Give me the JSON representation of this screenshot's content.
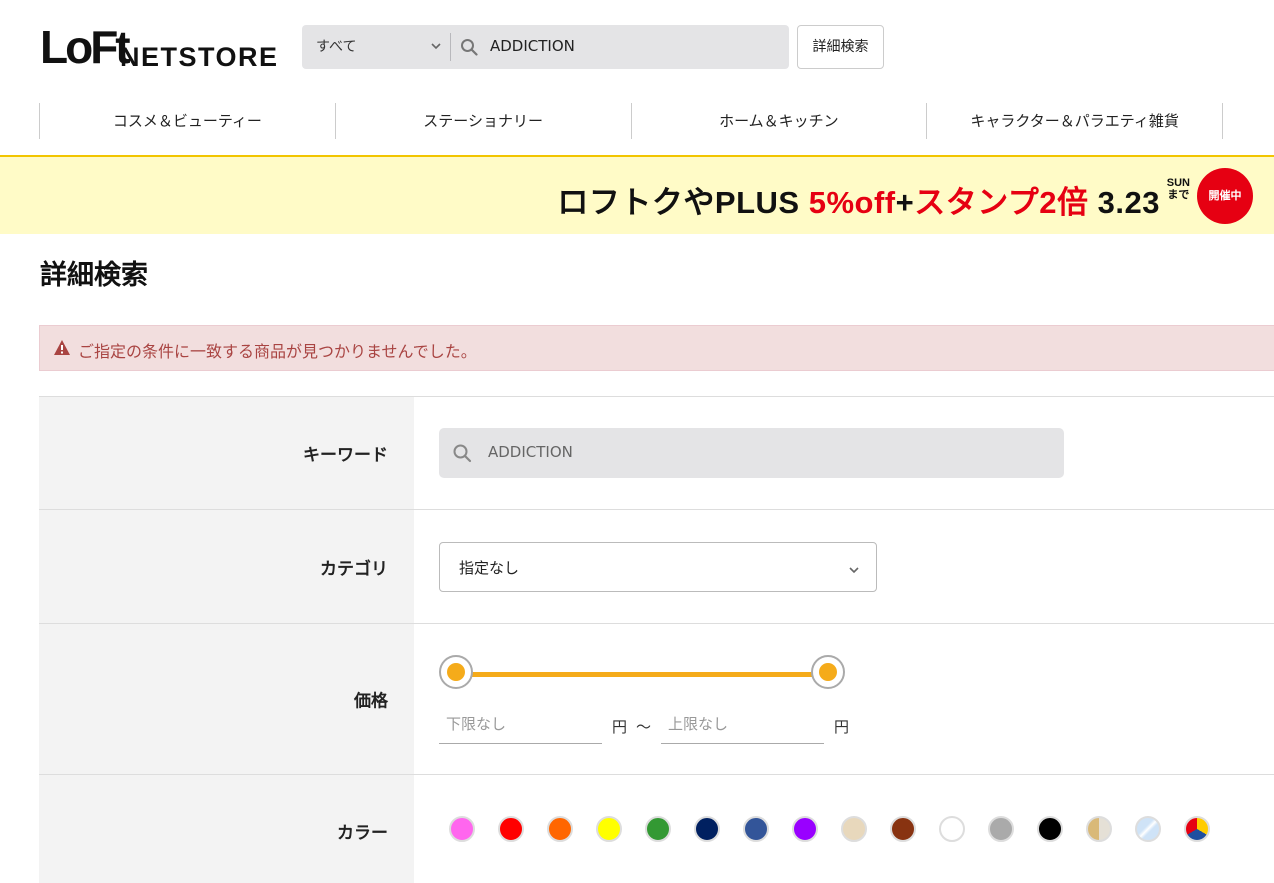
{
  "header": {
    "logo_mark": "LoFt",
    "logo_text": "NETSTORE",
    "search": {
      "scope_selected": "すべて",
      "value": "ADDICTION"
    },
    "advanced_search_label": "詳細検索"
  },
  "nav": {
    "items": [
      {
        "label": "コスメ＆ビューティー"
      },
      {
        "label": "ステーショナリー"
      },
      {
        "label": "ホーム＆キッチン"
      },
      {
        "label": "キャラクター＆パラエティ雑貨"
      }
    ]
  },
  "banner": {
    "part1": "ロフトクやPLUS ",
    "part2": "5%off",
    "part3": "+",
    "part4": "スタンプ2倍 ",
    "part5": "3.23",
    "day_label": "SUN",
    "made_label": "まで",
    "badge": "開催中",
    "colors": {
      "background": "#fffbc7",
      "accent": "#e60012"
    }
  },
  "page": {
    "title": "詳細検索"
  },
  "alert": {
    "text": "ご指定の条件に一致する商品が見つかりませんでした。"
  },
  "form": {
    "keyword": {
      "label": "キーワード",
      "value": "ADDICTION"
    },
    "category": {
      "label": "カテゴリ",
      "selected": "指定なし"
    },
    "price": {
      "label": "価格",
      "min_placeholder": "下限なし",
      "max_placeholder": "上限なし",
      "unit": "円",
      "separator": "〜",
      "slider_min_fraction": 0,
      "slider_max_fraction": 1
    },
    "color": {
      "label": "カラー",
      "swatches": [
        {
          "name": "pink",
          "color": "#ff66ee"
        },
        {
          "name": "red",
          "color": "#ff0000"
        },
        {
          "name": "orange",
          "color": "#ff6600"
        },
        {
          "name": "yellow",
          "color": "#ffff00"
        },
        {
          "name": "green",
          "color": "#339933"
        },
        {
          "name": "navy",
          "color": "#002060"
        },
        {
          "name": "blue",
          "color": "#335599"
        },
        {
          "name": "purple",
          "color": "#9900ff"
        },
        {
          "name": "beige",
          "color": "#e8d8bc"
        },
        {
          "name": "brown",
          "color": "#883311"
        },
        {
          "name": "white",
          "color": "#ffffff"
        },
        {
          "name": "gray",
          "color": "#aaaaaa"
        },
        {
          "name": "black",
          "color": "#000000"
        },
        {
          "name": "gold",
          "color": "#cfb27a"
        },
        {
          "name": "clear",
          "color": "#cfe3f7"
        },
        {
          "name": "multi",
          "color": "#ffcc00"
        }
      ]
    }
  }
}
